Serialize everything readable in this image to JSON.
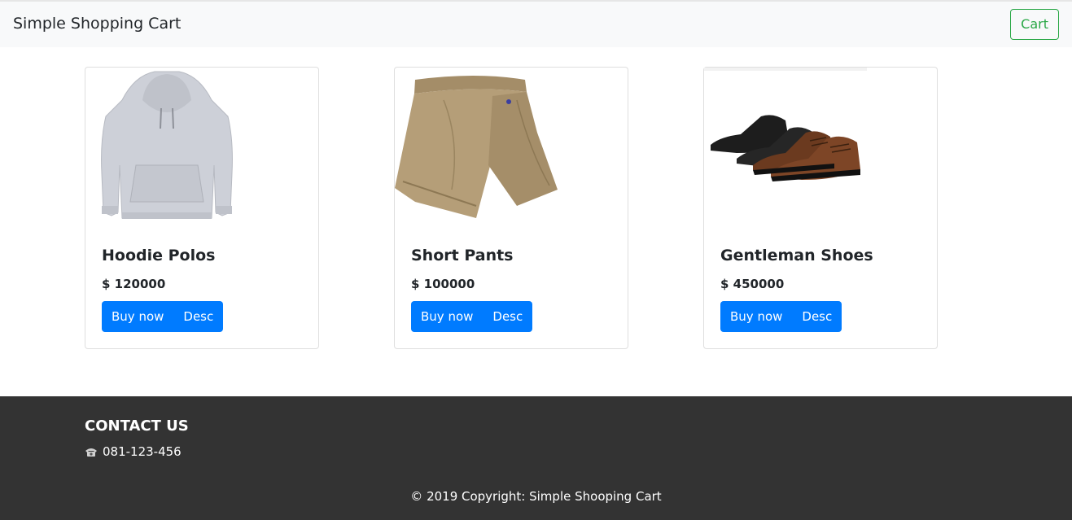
{
  "navbar": {
    "brand": "Simple Shopping Cart",
    "cart_label": "Cart"
  },
  "products": [
    {
      "name": "Hoodie Polos",
      "price": "$ 120000",
      "buy_label": "Buy now",
      "desc_label": "Desc",
      "image": "hoodie-image"
    },
    {
      "name": "Short Pants",
      "price": "$ 100000",
      "buy_label": "Buy now",
      "desc_label": "Desc",
      "image": "shorts-image"
    },
    {
      "name": "Gentleman Shoes",
      "price": "$ 450000",
      "buy_label": "Buy now",
      "desc_label": "Desc",
      "image": "shoes-image"
    }
  ],
  "footer": {
    "contact_title": "CONTACT US",
    "phone": "081-123-456",
    "phone_icon": "phone-icon",
    "copyright": "© 2019 Copyright: Simple Shooping Cart"
  },
  "colors": {
    "primary": "#007bff",
    "success": "#28a745",
    "footer_bg": "#333333",
    "navbar_bg": "#f8f9fa"
  }
}
